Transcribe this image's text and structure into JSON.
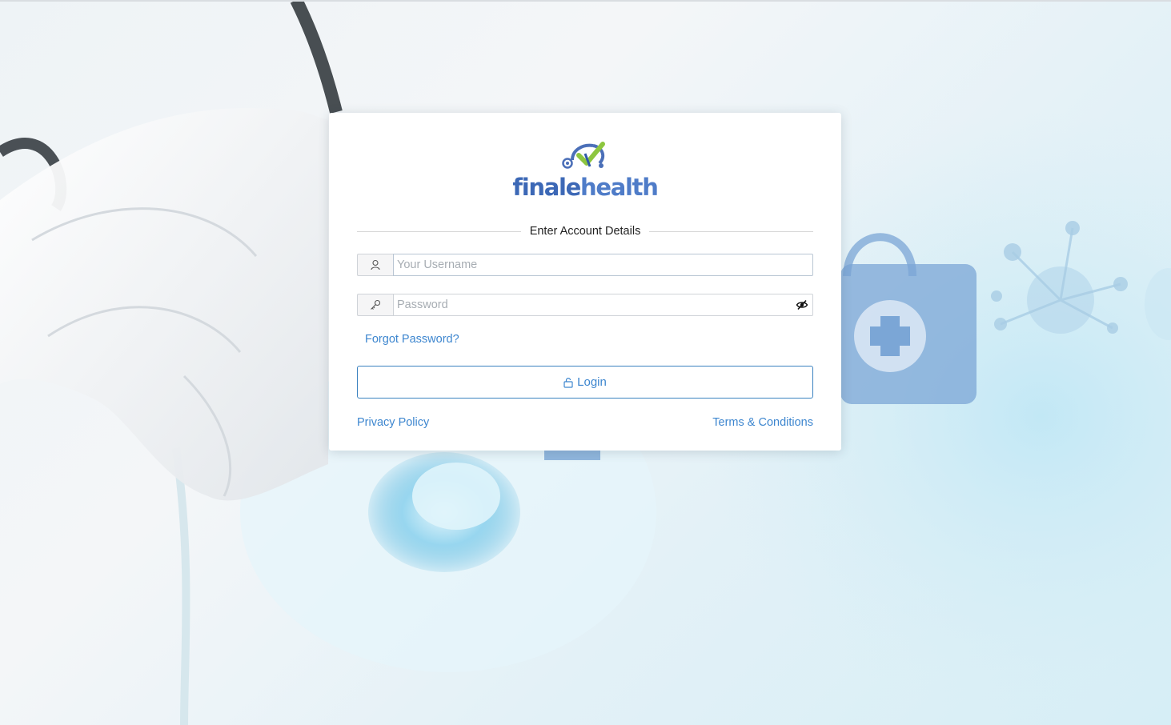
{
  "brand": {
    "name_part1": "finale",
    "name_part2": "health",
    "logo_icon": "stethoscope-check-icon",
    "colors": {
      "primary": "#3c68b6",
      "accent_green": "#8dc63f",
      "link": "#3d86cf"
    }
  },
  "form": {
    "heading": "Enter Account Details",
    "username": {
      "placeholder": "Your Username",
      "value": "",
      "icon": "user-icon"
    },
    "password": {
      "placeholder": "Password",
      "value": "",
      "icon": "key-icon",
      "toggle_icon": "eye-slash-icon"
    },
    "forgot_password_label": "Forgot Password?",
    "login_label": "Login",
    "login_icon": "unlock-icon"
  },
  "footer": {
    "privacy_label": "Privacy Policy",
    "terms_label": "Terms & Conditions"
  }
}
